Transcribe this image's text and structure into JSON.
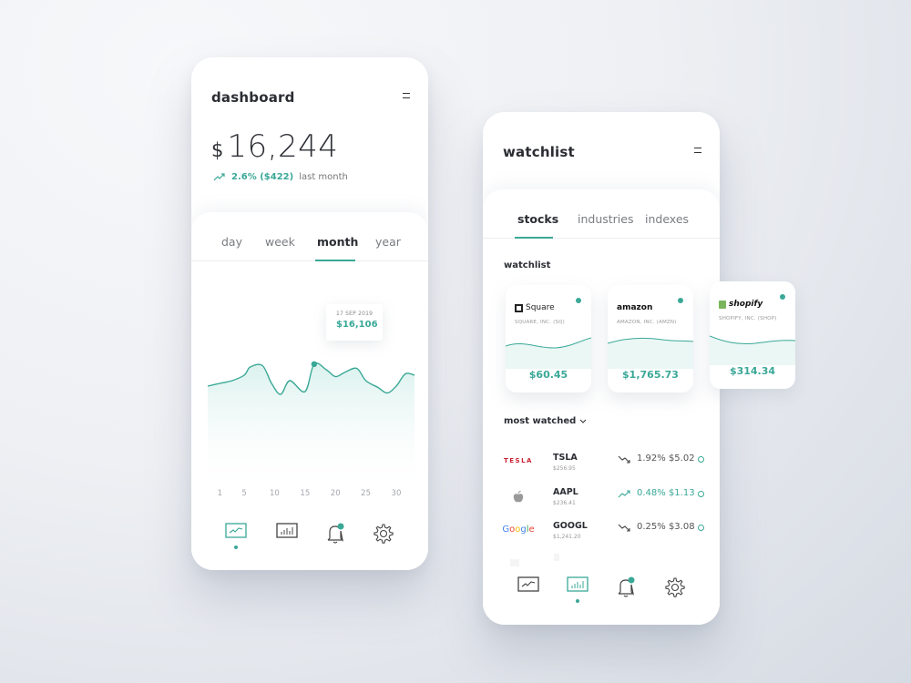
{
  "dashboard": {
    "title": "dashboard",
    "menu_icon": "hamburger-icon",
    "balance_currency": "$",
    "balance_amount": "16,244",
    "change_icon": "trending-up-icon",
    "change_value": "2.6% ($422)",
    "change_period": "last month",
    "tabs": [
      {
        "label": "day",
        "active": false
      },
      {
        "label": "week",
        "active": false
      },
      {
        "label": "month",
        "active": true
      },
      {
        "label": "year",
        "active": false
      }
    ],
    "tooltip": {
      "date": "17 SEP 2019",
      "value": "$16,106"
    },
    "nav": [
      {
        "icon": "line-chart-icon",
        "active": true
      },
      {
        "icon": "bar-chart-icon",
        "active": false
      },
      {
        "icon": "bell-icon",
        "active": false,
        "badge": true
      },
      {
        "icon": "gear-icon",
        "active": false
      }
    ]
  },
  "chart_data": {
    "type": "area",
    "title": "",
    "xlabel": "",
    "ylabel": "",
    "x_ticks": [
      "1",
      "5",
      "10",
      "15",
      "20",
      "25",
      "30"
    ],
    "x": [
      -1,
      1,
      3,
      5,
      6,
      8,
      9.5,
      11,
      12.5,
      15,
      16.5,
      18.5,
      20,
      21.5,
      23.5,
      25,
      27,
      28.5,
      30,
      31.5,
      33
    ],
    "values": [
      15300,
      15400,
      15500,
      15700,
      16000,
      16050,
      15400,
      15000,
      15500,
      15100,
      16106,
      15900,
      15650,
      15800,
      15950,
      15500,
      15250,
      15050,
      15300,
      15750,
      15700
    ],
    "highlight": {
      "x": 16.5,
      "label": "17 SEP 2019",
      "value": 16106
    },
    "color": "#3aa897",
    "grid": false
  },
  "watchlist": {
    "title": "watchlist",
    "menu_icon": "hamburger-icon",
    "tabs": [
      {
        "label": "stocks",
        "active": true
      },
      {
        "label": "industries",
        "active": false
      },
      {
        "label": "indexes",
        "active": false
      }
    ],
    "section_label": "watchlist",
    "cards": [
      {
        "brand": "Square",
        "company": "SQUARE, INC. (SQ)",
        "price": "$60.45"
      },
      {
        "brand": "amazon",
        "company": "AMAZON, INC. (AMZN)",
        "price": "$1,765.73"
      },
      {
        "brand": "shopify",
        "company": "SHOPIFY, INC. (SHOP)",
        "price": "$314.34"
      }
    ],
    "most_watched_label": "most watched",
    "most_watched": [
      {
        "brand": "TESLA",
        "symbol": "TSLA",
        "price": "$256.95",
        "direction": "down",
        "change": "1.92% $5.02"
      },
      {
        "brand": "apple",
        "symbol": "AAPL",
        "price": "$236.41",
        "direction": "up",
        "change": "0.48% $1.13"
      },
      {
        "brand": "Google",
        "symbol": "GOOGL",
        "price": "$1,241.20",
        "direction": "down",
        "change": "0.25% $3.08"
      }
    ],
    "nav": [
      {
        "icon": "line-chart-icon",
        "active": false
      },
      {
        "icon": "bar-chart-icon",
        "active": true
      },
      {
        "icon": "bell-icon",
        "active": false,
        "badge": true
      },
      {
        "icon": "gear-icon",
        "active": false
      }
    ]
  },
  "colors": {
    "accent": "#3aa897",
    "text": "#2b2d33",
    "muted": "#7a7c82"
  }
}
